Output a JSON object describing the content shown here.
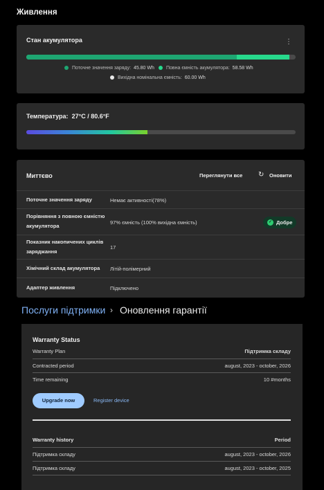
{
  "page": {
    "title": "Живлення"
  },
  "battery": {
    "title": "Стан акумулятора",
    "charge_fraction": 0.782,
    "full_fraction": 0.976,
    "legend": {
      "current_label": "Поточне значення заряду:",
      "current_value": "45.80 Wh",
      "full_label": "Повна ємність акумулятора:",
      "full_value": "58.58 Wh",
      "design_label": "Вихідна номінальна ємність:",
      "design_value": "60.00 Wh"
    },
    "colors": {
      "current": "#1ea672",
      "full": "#27d98c",
      "design": "#e8e8e8",
      "track": "#4a4a4a"
    }
  },
  "temperature": {
    "label": "Температура:",
    "value": "27°C / 80.6°F",
    "fraction": 0.45
  },
  "instant": {
    "title": "Миттєво",
    "view_all": "Переглянути все",
    "refresh": "Оновити",
    "rows": [
      {
        "label": "Поточне значення заряду",
        "value": "Немає активності(78%)"
      },
      {
        "label": "Порівняння з повною ємністю акумулятора",
        "value": "97% ємність (100% вихідна ємність)",
        "badge": "Добре"
      },
      {
        "label": "Показник накопичених циклів заряджання",
        "value": "17"
      },
      {
        "label": "Хімічний склад акумулятора",
        "value": "Літій-полімерний"
      },
      {
        "label": "Адаптер живлення",
        "value": "Підключено"
      }
    ]
  },
  "breadcrumb": {
    "parent": "Послуги підтримки",
    "current": "Оновлення гарантії"
  },
  "warranty": {
    "status_title": "Warranty Status",
    "plan_label": "Warranty Plan",
    "plan_value": "Підтримка складу",
    "contracted_label": "Contracted period",
    "contracted_value": "august, 2023 - october, 2026",
    "remaining_label": "Time remaining",
    "remaining_value": "10 #months",
    "upgrade_button": "Upgrade now",
    "register_link": "Register device",
    "history_title": "Warranty history",
    "history_period_header": "Period",
    "history": [
      {
        "plan": "Підтримка складу",
        "period": "august, 2023 - october, 2026"
      },
      {
        "plan": "Підтримка складу",
        "period": "august, 2023 - october, 2025"
      }
    ]
  }
}
